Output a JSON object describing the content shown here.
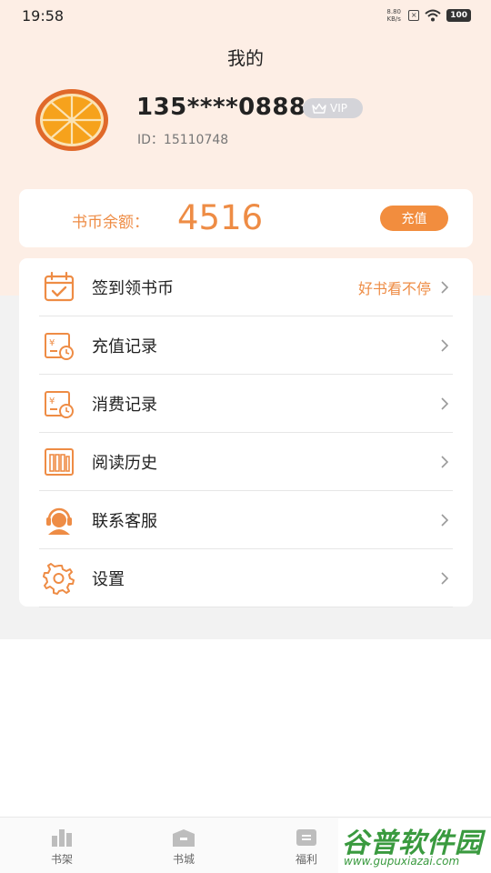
{
  "status_bar": {
    "time": "19:58",
    "net_speed_value": "8.80",
    "net_speed_unit": "KB/s",
    "battery": "100"
  },
  "header": {
    "title": "我的"
  },
  "profile": {
    "phone": "135****0888",
    "vip_label": "VIP",
    "user_id": "ID：15110748"
  },
  "balance": {
    "label": "书币余额：",
    "value": "4516",
    "recharge_label": "充值"
  },
  "menu": {
    "items": [
      {
        "label": "签到领书币",
        "extra": "好书看不停",
        "icon": "calendar-check-icon"
      },
      {
        "label": "充值记录",
        "icon": "recharge-record-icon"
      },
      {
        "label": "消费记录",
        "icon": "consume-record-icon"
      },
      {
        "label": "阅读历史",
        "icon": "books-icon"
      },
      {
        "label": "联系客服",
        "icon": "customer-service-icon"
      },
      {
        "label": "设置",
        "icon": "gear-icon"
      }
    ]
  },
  "bottom_nav": {
    "items": [
      {
        "label": "书架",
        "icon": "bookshelf-icon"
      },
      {
        "label": "书城",
        "icon": "bookstore-icon"
      },
      {
        "label": "福利",
        "icon": "welfare-icon"
      }
    ]
  },
  "watermark": {
    "title": "谷普软件园",
    "url": "www.gupuxiazai.com"
  },
  "colors": {
    "accent": "#f28d3e",
    "header_bg": "#fdeee5",
    "section_bg": "#f2f2f2"
  }
}
